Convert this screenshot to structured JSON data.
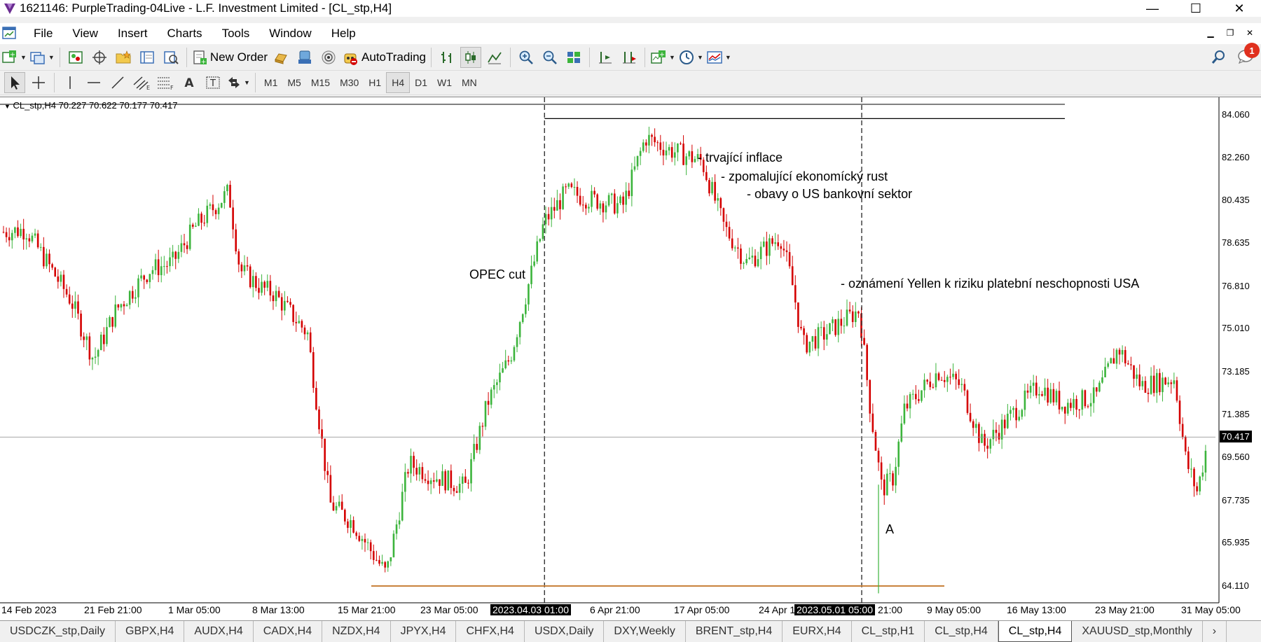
{
  "window": {
    "title": "1621146: PurpleTrading-04Live - L.F. Investment Limited - [CL_stp,H4]",
    "controls": [
      "—",
      "☐",
      "✕"
    ]
  },
  "menu": [
    "File",
    "View",
    "Insert",
    "Charts",
    "Tools",
    "Window",
    "Help"
  ],
  "toolbar": {
    "new_order_label": "New Order",
    "autotrading_label": "AutoTrading",
    "notification_count": "1"
  },
  "timeframes": [
    "M1",
    "M5",
    "M15",
    "M30",
    "H1",
    "H4",
    "D1",
    "W1",
    "MN"
  ],
  "active_timeframe": "H4",
  "chart": {
    "info": "CL_stp,H4  70.227 70.622 70.177 70.417",
    "current_price_label": "70.417",
    "annotations": {
      "opec": "OPEC cut",
      "inflation": "- trvající inflace",
      "growth": "- zpomalující ekonomícký rust",
      "banking": "- obavy o US bankovní sektor",
      "yellen": "- oznámení Yellen k riziku platební neschopnosti USA",
      "point_a": "A"
    },
    "price_ticks": [
      "84.060",
      "82.260",
      "80.435",
      "78.635",
      "76.810",
      "75.010",
      "73.185",
      "71.385",
      "69.560",
      "67.735",
      "65.935",
      "64.110"
    ],
    "date_ticks": [
      "14 Feb 2023",
      "21 Feb 21:00",
      "1 Mar 05:00",
      "8 Mar 13:00",
      "15 Mar 21:00",
      "23 Mar 05:00",
      "2023.04.03 01:00",
      "6 Apr 21:00",
      "17 Apr 05:00",
      "24 Apr 1",
      "2023.05.01 05:00",
      "21:00",
      "9 May 05:00",
      "16 May 13:00",
      "23 May 21:00",
      "31 May 05:00"
    ]
  },
  "colors": {
    "bull": "#3cb43c",
    "bear": "#d40000",
    "support": "#c8823c"
  },
  "tabs": [
    "USDCZK_stp,Daily",
    "GBPX,H4",
    "AUDX,H4",
    "CADX,H4",
    "NZDX,H4",
    "JPYX,H4",
    "CHFX,H4",
    "USDX,Daily",
    "DXY,Weekly",
    "BRENT_stp,H4",
    "EURX,H4",
    "CL_stp,H1",
    "CL_stp,H4",
    "CL_stp,H4",
    "XAUUSD_stp,Monthly"
  ],
  "active_tab_index": 13,
  "chart_data": {
    "type": "candlestick",
    "symbol": "CL_stp",
    "timeframe": "H4",
    "ohlc_current": {
      "open": 70.227,
      "high": 70.622,
      "low": 70.177,
      "close": 70.417
    },
    "ylim": [
      63.4,
      84.8
    ],
    "anchors": [
      {
        "date": "14 Feb 2023",
        "price": 79.1
      },
      {
        "date": "16 Feb 2023",
        "price": 79.2
      },
      {
        "date": "20 Feb 2023",
        "price": 76.2
      },
      {
        "date": "22 Feb 2023",
        "price": 73.7
      },
      {
        "date": "24 Feb 2023",
        "price": 75.8
      },
      {
        "date": "27 Feb 2023",
        "price": 77.5
      },
      {
        "date": "1 Mar 2023",
        "price": 77.8
      },
      {
        "date": "3 Mar 2023",
        "price": 79.3
      },
      {
        "date": "6 Mar 2023",
        "price": 80.8
      },
      {
        "date": "7 Mar 2023",
        "price": 77.5
      },
      {
        "date": "9 Mar 2023",
        "price": 76.7
      },
      {
        "date": "10 Mar 2023",
        "price": 76.5
      },
      {
        "date": "13 Mar 2023",
        "price": 74.8
      },
      {
        "date": "14 Mar 2023",
        "price": 71.2
      },
      {
        "date": "15 Mar 2023",
        "price": 67.6
      },
      {
        "date": "17 Mar 2023",
        "price": 66.8
      },
      {
        "date": "20 Mar 2023",
        "price": 64.6
      },
      {
        "date": "22 Mar 2023",
        "price": 69.3
      },
      {
        "date": "24 Mar 2023",
        "price": 68.8
      },
      {
        "date": "27 Mar 2023",
        "price": 68.3
      },
      {
        "date": "29 Mar 2023",
        "price": 71.9
      },
      {
        "date": "31 Mar 2023",
        "price": 73.8
      },
      {
        "date": "3 Apr 2023",
        "price": 79.5
      },
      {
        "date": "5 Apr 2023",
        "price": 80.8
      },
      {
        "date": "7 Apr 2023",
        "price": 80.5
      },
      {
        "date": "10 Apr 2023",
        "price": 80.2
      },
      {
        "date": "12 Apr 2023",
        "price": 83.1
      },
      {
        "date": "14 Apr 2023",
        "price": 82.6
      },
      {
        "date": "17 Apr 2023",
        "price": 82.1
      },
      {
        "date": "19 Apr 2023",
        "price": 79.3
      },
      {
        "date": "21 Apr 2023",
        "price": 77.8
      },
      {
        "date": "24 Apr 2023",
        "price": 78.9
      },
      {
        "date": "25 Apr 2023",
        "price": 77.0
      },
      {
        "date": "26 Apr 2023",
        "price": 74.3
      },
      {
        "date": "28 Apr 2023",
        "price": 74.8
      },
      {
        "date": "1 May 2023",
        "price": 75.8
      },
      {
        "date": "2 May 2023",
        "price": 71.5
      },
      {
        "date": "3 May 2023",
        "price": 68.2
      },
      {
        "date": "4 May 2023",
        "price": 68.7
      },
      {
        "date": "5 May 2023",
        "price": 71.6
      },
      {
        "date": "8 May 2023",
        "price": 73.2
      },
      {
        "date": "10 May 2023",
        "price": 72.6
      },
      {
        "date": "12 May 2023",
        "price": 70.0
      },
      {
        "date": "15 May 2023",
        "price": 71.6
      },
      {
        "date": "17 May 2023",
        "price": 72.6
      },
      {
        "date": "19 May 2023",
        "price": 71.8
      },
      {
        "date": "22 May 2023",
        "price": 72.1
      },
      {
        "date": "24 May 2023",
        "price": 74.2
      },
      {
        "date": "26 May 2023",
        "price": 72.6
      },
      {
        "date": "29 May 2023",
        "price": 72.9
      },
      {
        "date": "30 May 2023",
        "price": 69.4
      },
      {
        "date": "31 May 2023",
        "price": 68.1
      },
      {
        "date": "1 Jun 2023",
        "price": 70.4
      }
    ],
    "support_level": 64.11,
    "vertical_markers": [
      "2023.04.03 01:00",
      "2023.05.01 05:00"
    ],
    "resistance_level": 83.9
  }
}
